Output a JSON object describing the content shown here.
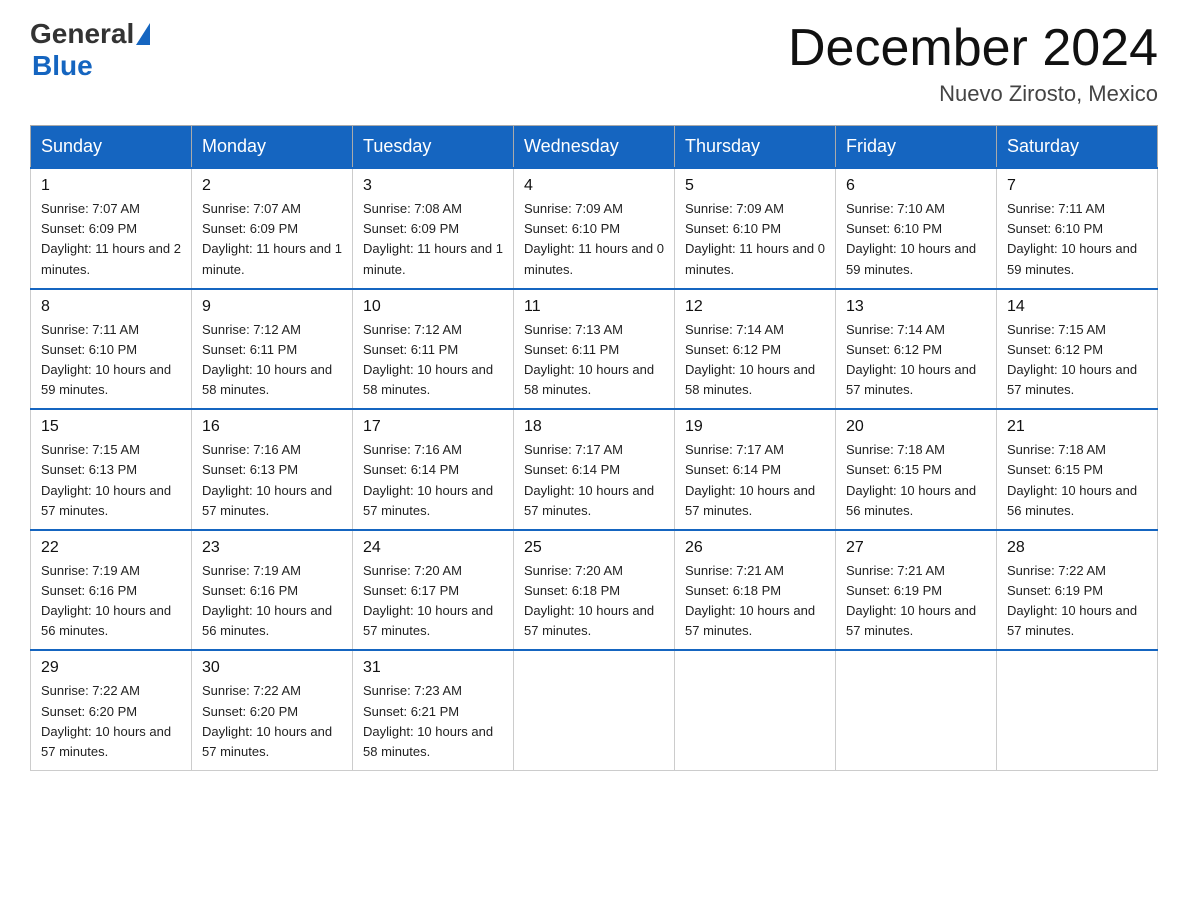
{
  "header": {
    "logo_general": "General",
    "logo_blue": "Blue",
    "title": "December 2024",
    "location": "Nuevo Zirosto, Mexico"
  },
  "weekdays": [
    "Sunday",
    "Monday",
    "Tuesday",
    "Wednesday",
    "Thursday",
    "Friday",
    "Saturday"
  ],
  "weeks": [
    [
      {
        "day": "1",
        "sunrise": "7:07 AM",
        "sunset": "6:09 PM",
        "daylight": "11 hours and 2 minutes."
      },
      {
        "day": "2",
        "sunrise": "7:07 AM",
        "sunset": "6:09 PM",
        "daylight": "11 hours and 1 minute."
      },
      {
        "day": "3",
        "sunrise": "7:08 AM",
        "sunset": "6:09 PM",
        "daylight": "11 hours and 1 minute."
      },
      {
        "day": "4",
        "sunrise": "7:09 AM",
        "sunset": "6:10 PM",
        "daylight": "11 hours and 0 minutes."
      },
      {
        "day": "5",
        "sunrise": "7:09 AM",
        "sunset": "6:10 PM",
        "daylight": "11 hours and 0 minutes."
      },
      {
        "day": "6",
        "sunrise": "7:10 AM",
        "sunset": "6:10 PM",
        "daylight": "10 hours and 59 minutes."
      },
      {
        "day": "7",
        "sunrise": "7:11 AM",
        "sunset": "6:10 PM",
        "daylight": "10 hours and 59 minutes."
      }
    ],
    [
      {
        "day": "8",
        "sunrise": "7:11 AM",
        "sunset": "6:10 PM",
        "daylight": "10 hours and 59 minutes."
      },
      {
        "day": "9",
        "sunrise": "7:12 AM",
        "sunset": "6:11 PM",
        "daylight": "10 hours and 58 minutes."
      },
      {
        "day": "10",
        "sunrise": "7:12 AM",
        "sunset": "6:11 PM",
        "daylight": "10 hours and 58 minutes."
      },
      {
        "day": "11",
        "sunrise": "7:13 AM",
        "sunset": "6:11 PM",
        "daylight": "10 hours and 58 minutes."
      },
      {
        "day": "12",
        "sunrise": "7:14 AM",
        "sunset": "6:12 PM",
        "daylight": "10 hours and 58 minutes."
      },
      {
        "day": "13",
        "sunrise": "7:14 AM",
        "sunset": "6:12 PM",
        "daylight": "10 hours and 57 minutes."
      },
      {
        "day": "14",
        "sunrise": "7:15 AM",
        "sunset": "6:12 PM",
        "daylight": "10 hours and 57 minutes."
      }
    ],
    [
      {
        "day": "15",
        "sunrise": "7:15 AM",
        "sunset": "6:13 PM",
        "daylight": "10 hours and 57 minutes."
      },
      {
        "day": "16",
        "sunrise": "7:16 AM",
        "sunset": "6:13 PM",
        "daylight": "10 hours and 57 minutes."
      },
      {
        "day": "17",
        "sunrise": "7:16 AM",
        "sunset": "6:14 PM",
        "daylight": "10 hours and 57 minutes."
      },
      {
        "day": "18",
        "sunrise": "7:17 AM",
        "sunset": "6:14 PM",
        "daylight": "10 hours and 57 minutes."
      },
      {
        "day": "19",
        "sunrise": "7:17 AM",
        "sunset": "6:14 PM",
        "daylight": "10 hours and 57 minutes."
      },
      {
        "day": "20",
        "sunrise": "7:18 AM",
        "sunset": "6:15 PM",
        "daylight": "10 hours and 56 minutes."
      },
      {
        "day": "21",
        "sunrise": "7:18 AM",
        "sunset": "6:15 PM",
        "daylight": "10 hours and 56 minutes."
      }
    ],
    [
      {
        "day": "22",
        "sunrise": "7:19 AM",
        "sunset": "6:16 PM",
        "daylight": "10 hours and 56 minutes."
      },
      {
        "day": "23",
        "sunrise": "7:19 AM",
        "sunset": "6:16 PM",
        "daylight": "10 hours and 56 minutes."
      },
      {
        "day": "24",
        "sunrise": "7:20 AM",
        "sunset": "6:17 PM",
        "daylight": "10 hours and 57 minutes."
      },
      {
        "day": "25",
        "sunrise": "7:20 AM",
        "sunset": "6:18 PM",
        "daylight": "10 hours and 57 minutes."
      },
      {
        "day": "26",
        "sunrise": "7:21 AM",
        "sunset": "6:18 PM",
        "daylight": "10 hours and 57 minutes."
      },
      {
        "day": "27",
        "sunrise": "7:21 AM",
        "sunset": "6:19 PM",
        "daylight": "10 hours and 57 minutes."
      },
      {
        "day": "28",
        "sunrise": "7:22 AM",
        "sunset": "6:19 PM",
        "daylight": "10 hours and 57 minutes."
      }
    ],
    [
      {
        "day": "29",
        "sunrise": "7:22 AM",
        "sunset": "6:20 PM",
        "daylight": "10 hours and 57 minutes."
      },
      {
        "day": "30",
        "sunrise": "7:22 AM",
        "sunset": "6:20 PM",
        "daylight": "10 hours and 57 minutes."
      },
      {
        "day": "31",
        "sunrise": "7:23 AM",
        "sunset": "6:21 PM",
        "daylight": "10 hours and 58 minutes."
      },
      null,
      null,
      null,
      null
    ]
  ],
  "labels": {
    "sunrise_prefix": "Sunrise: ",
    "sunset_prefix": "Sunset: ",
    "daylight_prefix": "Daylight: "
  }
}
